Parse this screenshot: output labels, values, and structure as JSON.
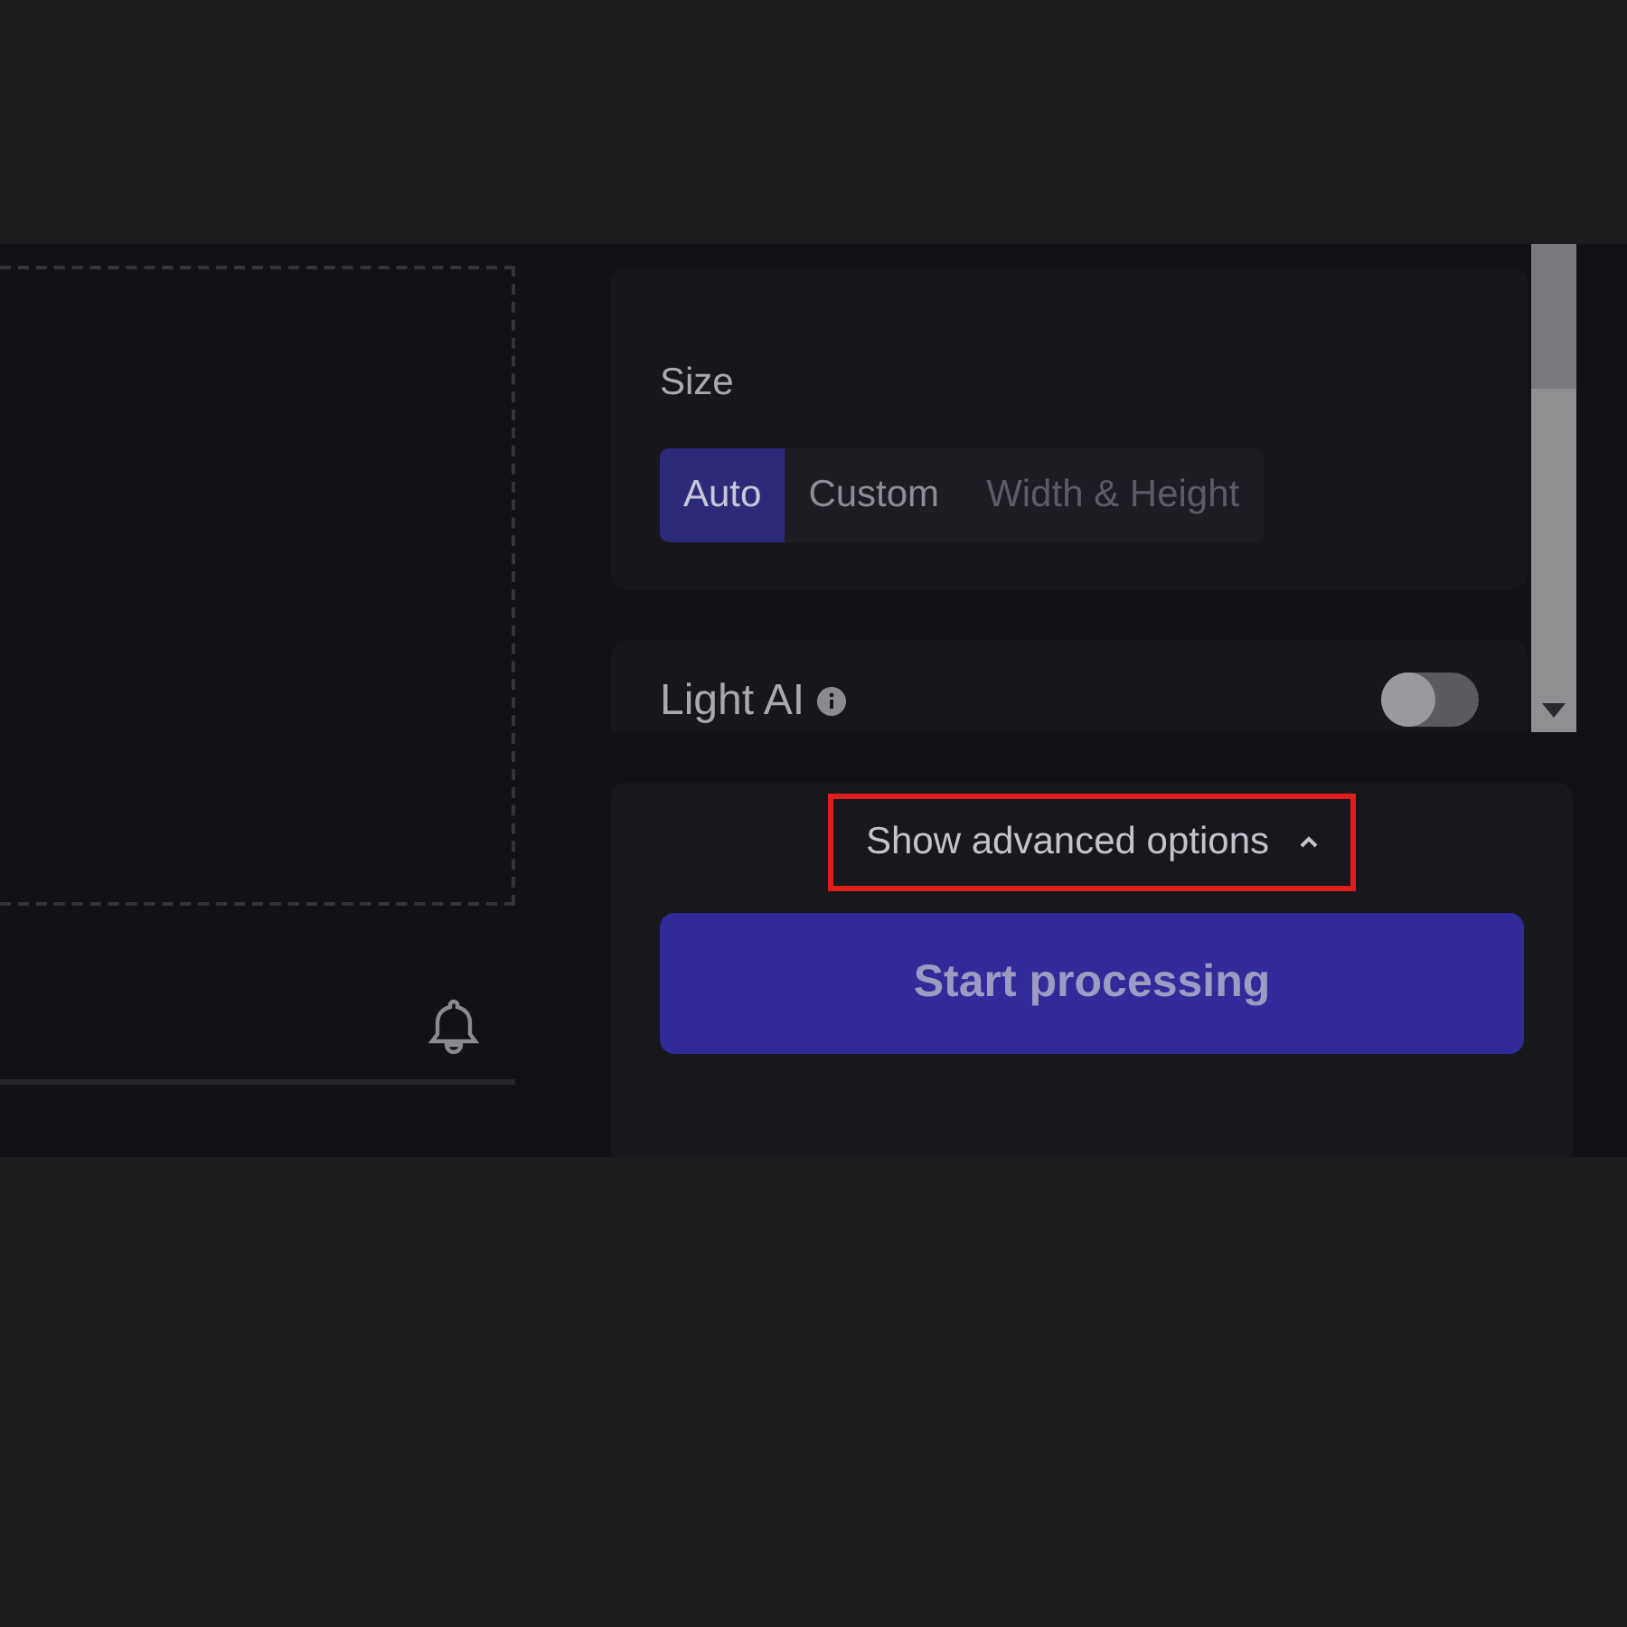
{
  "size_section": {
    "label": "Size",
    "options": [
      {
        "label": "Auto",
        "selected": true,
        "disabled": false
      },
      {
        "label": "Custom",
        "selected": false,
        "disabled": false
      },
      {
        "label": "Width & Height",
        "selected": false,
        "disabled": true
      }
    ]
  },
  "light_ai": {
    "label": "Light AI",
    "on": false
  },
  "advanced_toggle": {
    "label": "Show advanced options",
    "expanded": false,
    "highlighted": true
  },
  "start_button": {
    "label": "Start processing"
  }
}
